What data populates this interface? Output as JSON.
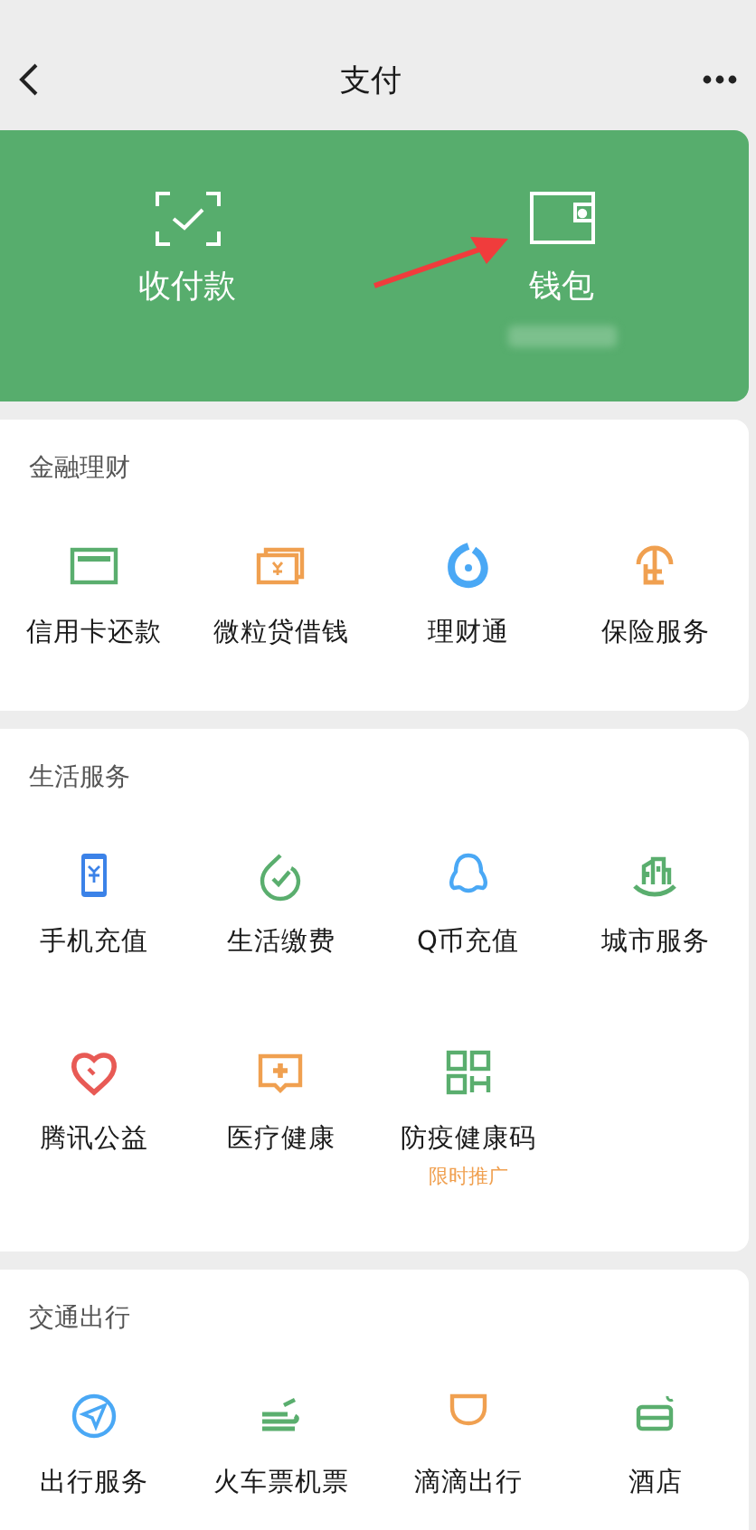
{
  "header": {
    "title": "支付"
  },
  "pay_card": {
    "items": [
      {
        "label": "收付款"
      },
      {
        "label": "钱包"
      }
    ]
  },
  "sections": [
    {
      "title": "金融理财",
      "items": [
        {
          "label": "信用卡还款"
        },
        {
          "label": "微粒贷借钱"
        },
        {
          "label": "理财通"
        },
        {
          "label": "保险服务"
        }
      ]
    },
    {
      "title": "生活服务",
      "items": [
        {
          "label": "手机充值"
        },
        {
          "label": "生活缴费"
        },
        {
          "label": "Q币充值"
        },
        {
          "label": "城市服务"
        },
        {
          "label": "腾讯公益"
        },
        {
          "label": "医疗健康"
        },
        {
          "label": "防疫健康码",
          "note": "限时推广"
        }
      ]
    },
    {
      "title": "交通出行",
      "items": [
        {
          "label": "出行服务"
        },
        {
          "label": "火车票机票"
        },
        {
          "label": "滴滴出行"
        },
        {
          "label": "酒店"
        }
      ]
    }
  ]
}
